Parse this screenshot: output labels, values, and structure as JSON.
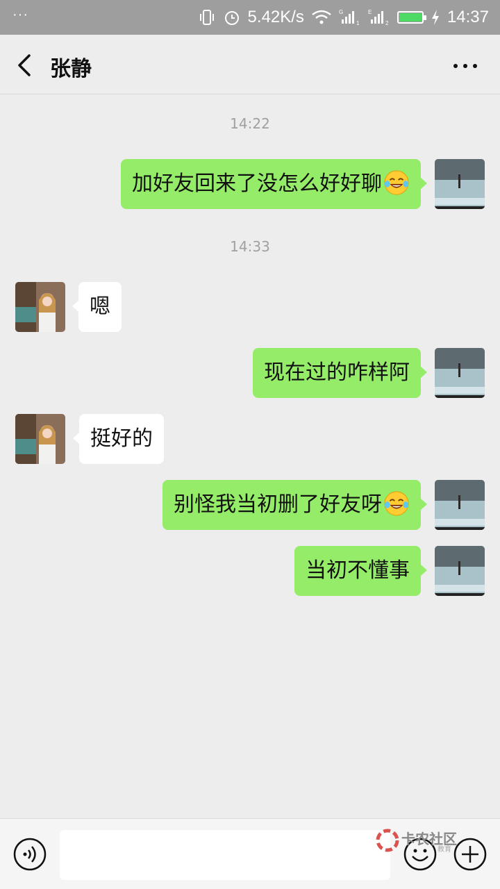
{
  "status_bar": {
    "dots": "···",
    "net_speed": "5.42K/s",
    "time": "14:37",
    "battery_level": 1.0,
    "sim1_label": "G",
    "sim1_num": "1",
    "sim2_label": "E",
    "sim2_num": "2"
  },
  "header": {
    "title": "张静",
    "back_icon": "back-chevron-icon",
    "more_icon": "more-dots-icon"
  },
  "messages": [
    {
      "type": "time",
      "text": "14:22"
    },
    {
      "type": "message",
      "from": "me",
      "text": "加好友回来了没怎么好好聊",
      "emoji": "laughing-tears-emoji"
    },
    {
      "type": "time",
      "text": "14:33"
    },
    {
      "type": "message",
      "from": "them",
      "text": "嗯"
    },
    {
      "type": "message",
      "from": "me",
      "text": "现在过的咋样阿"
    },
    {
      "type": "message",
      "from": "them",
      "text": "挺好的"
    },
    {
      "type": "message",
      "from": "me",
      "text": "别怪我当初删了好友呀",
      "emoji": "laughing-tears-emoji"
    },
    {
      "type": "message",
      "from": "me",
      "text": "当初不懂事"
    }
  ],
  "input_bar": {
    "voice_icon": "voice-icon",
    "input_value": "",
    "emoji_icon": "smiley-icon",
    "plus_icon": "plus-icon"
  },
  "watermark": {
    "text": "卡农社区",
    "sub": "教育"
  },
  "colors": {
    "my_bubble": "#95ec69",
    "their_bubble": "#ffffff",
    "background": "#ededed",
    "status_bar": "#9e9e9e"
  }
}
